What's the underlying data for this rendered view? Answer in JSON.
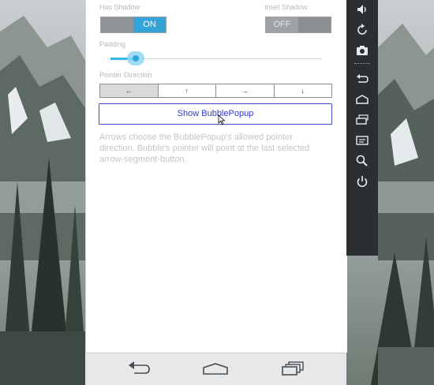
{
  "app": {
    "has_shadow_label": "Has Shadow",
    "inset_shadow_label": "Inset Shadow",
    "has_shadow_toggle": {
      "state": "ON",
      "on_text": "ON"
    },
    "inset_shadow_toggle": {
      "state": "OFF",
      "off_text": "OFF"
    },
    "padding_label": "Padding",
    "padding_level": 0.12,
    "pointer_direction_label": "Pointer Direction",
    "pointer_segments": [
      {
        "glyph": "←",
        "selected": true
      },
      {
        "glyph": "↑",
        "selected": false
      },
      {
        "glyph": "→",
        "selected": false
      },
      {
        "glyph": "↓",
        "selected": false
      }
    ],
    "show_button_label": "Show BubblePopup",
    "description": "Arrows choose the BubblePopup's allowed pointer direction.  Bubble's pointer will point at the last selected arrow-segment-button."
  },
  "navbar": {
    "buttons": [
      "back-icon",
      "home-icon",
      "recent-apps-icon"
    ]
  },
  "toolbar": {
    "tools": [
      "volume-icon",
      "rotate-icon",
      "camera-icon",
      "back-icon",
      "home-icon",
      "recent-apps-icon",
      "menu-icon",
      "search-icon",
      "power-icon"
    ]
  },
  "colors": {
    "accent": "#33b5e5",
    "button_text": "#2d3ad0",
    "toolbar_bg": "#2c2f31"
  }
}
